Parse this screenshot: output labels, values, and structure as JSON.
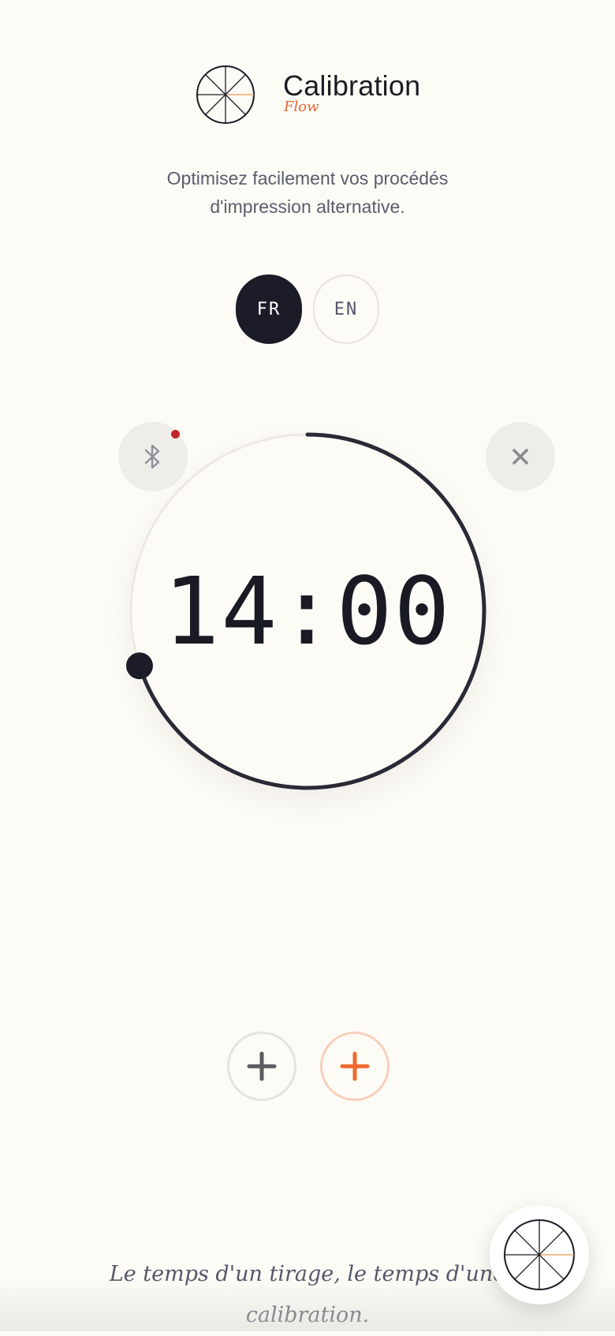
{
  "header": {
    "title": "Calibration",
    "subtitle": "Flow",
    "tagline_line1": "Optimisez facilement vos procédés",
    "tagline_line2": "d'impression alternative."
  },
  "language": {
    "options": [
      "FR",
      "EN"
    ],
    "selected": "FR"
  },
  "timer": {
    "display": "14:00",
    "progress_fraction": 0.7
  },
  "bluetooth": {
    "icon": "bluetooth-icon",
    "status_dot_color": "#c0272d"
  },
  "close": {
    "icon": "close-icon",
    "glyph": "×"
  },
  "controls": {
    "add_icon": "plus-icon",
    "add_accent_icon": "plus-icon"
  },
  "quote": {
    "line1": "Le temps d'un tirage, le temps d'une",
    "line2": "calibration."
  },
  "colors": {
    "background": "#fdfbf6",
    "primary_dark": "#1b1c27",
    "accent_orange": "#e5672e",
    "text_muted": "#5a5c6d"
  }
}
